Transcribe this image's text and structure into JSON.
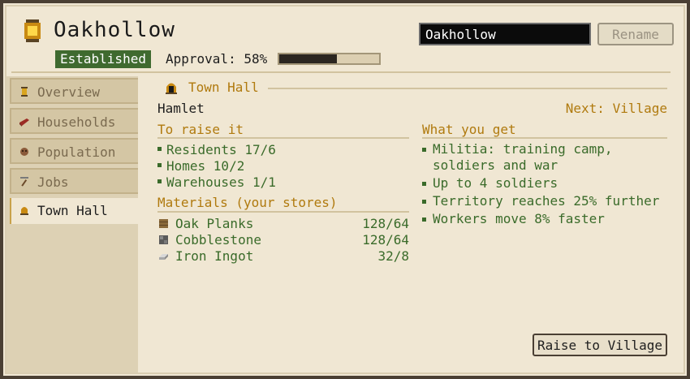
{
  "header": {
    "town_name": "Oakhollow",
    "name_input_value": "Oakhollow",
    "rename_label": "Rename",
    "status_badge": "Established",
    "approval_label": "Approval: 58%",
    "approval_fraction": 0.58
  },
  "sidebar": {
    "tabs": [
      {
        "label": "Overview",
        "icon": "lantern-icon"
      },
      {
        "label": "Households",
        "icon": "bed-icon"
      },
      {
        "label": "Population",
        "icon": "head-icon"
      },
      {
        "label": "Jobs",
        "icon": "pickaxe-icon"
      },
      {
        "label": "Town Hall",
        "icon": "bell-icon",
        "active": true
      }
    ]
  },
  "town_hall": {
    "section_title": "Town Hall",
    "current_tier": "Hamlet",
    "next_tier": "Next: Village",
    "requirements_heading": "To raise it",
    "requirements": [
      "Residents 17/6",
      "Homes 10/2",
      "Warehouses 1/1"
    ],
    "materials_heading": "Materials (your stores)",
    "materials": [
      {
        "name": "Oak Planks",
        "count": "128/64",
        "icon": "oak-planks-icon"
      },
      {
        "name": "Cobblestone",
        "count": "128/64",
        "icon": "cobblestone-icon"
      },
      {
        "name": "Iron Ingot",
        "count": "32/8",
        "icon": "iron-ingot-icon"
      }
    ],
    "benefits_heading": "What you get",
    "benefits": [
      "Militia: training camp, soldiers and war",
      "Up to 4 soldiers",
      "Territory reaches 25% further",
      "Workers move 8% faster"
    ],
    "raise_button": "Raise to Village"
  },
  "colors": {
    "accent_gold": "#b07a0e",
    "positive_green": "#3a6b2a",
    "badge_green": "#3f6a2f",
    "panel_bg": "#f0e7d3"
  }
}
